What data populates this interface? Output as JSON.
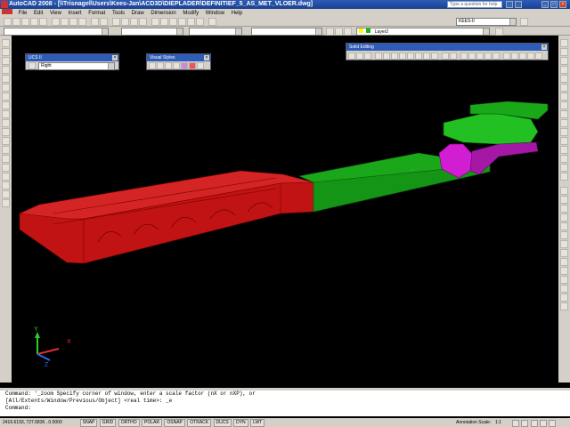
{
  "window": {
    "title": "AutoCAD 2008 - [\\\\Trisnagel\\Users\\Kees-Jan\\ACD3D\\DIEPLADER\\DEFINITIEF_5_AS_MET_VLOER.dwg]",
    "search_placeholder": "Type a question for help"
  },
  "menu": [
    "File",
    "Edit",
    "View",
    "Insert",
    "Format",
    "Tools",
    "Draw",
    "Dimension",
    "Modify",
    "Window",
    "Help"
  ],
  "toolbar": {
    "workspace_value": "KEES-II",
    "layer_value": "Layer2"
  },
  "panels": {
    "ucs": {
      "title": "UCS II",
      "value": "Right"
    },
    "visual_styles": {
      "title": "Visual Styles"
    },
    "solid_editing": {
      "title": "Solid Editing"
    }
  },
  "command": {
    "line1": "Command: '_zoom Specify corner of window, enter a scale factor (nX or nXP), or",
    "line2": "[All/Extents/Window/Previous/Object] <real time>: _e",
    "line3": "Command:"
  },
  "status": {
    "coordinates": "2416.6193, 727.6836 , 0.0000",
    "toggles": [
      "SNAP",
      "GRID",
      "ORTHO",
      "POLAR",
      "OSNAP",
      "OTRACK",
      "DUCS",
      "DYN",
      "LWT"
    ],
    "annotation_scale_label": "Annotation Scale:",
    "annotation_scale_value": "1:1"
  },
  "ucs_icon": {
    "x_label": "X",
    "y_label": "Y",
    "z_label": "Z"
  },
  "colors": {
    "red_part": "#c41414",
    "green_part": "#18b018",
    "magenta_part": "#d21ed2"
  }
}
